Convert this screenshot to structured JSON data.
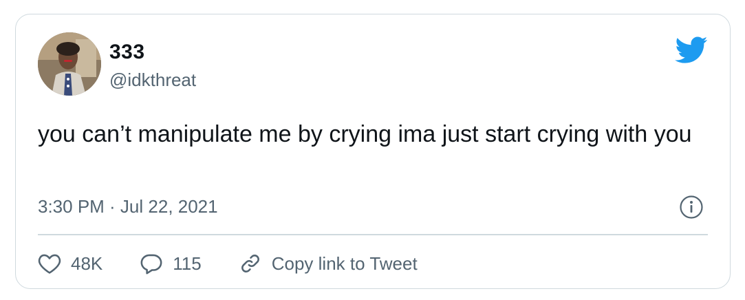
{
  "author": {
    "display_name": "333",
    "handle": "@idkthreat",
    "avatar_icon": "profile-photo"
  },
  "tweet": {
    "text": "you can’t manipulate me by crying ima just start crying with you",
    "timestamp": "3:30 PM · Jul 22, 2021"
  },
  "actions": {
    "likes_count": "48K",
    "replies_count": "115",
    "copy_link_label": "Copy link to Tweet"
  },
  "icons": {
    "brand": "twitter-bird-icon",
    "info": "info-icon",
    "like": "heart-icon",
    "reply": "reply-icon",
    "link": "link-icon"
  },
  "colors": {
    "brand_blue": "#1d9bf0",
    "text_primary": "#0f1419",
    "text_secondary": "#536471",
    "border": "#cfd9de"
  }
}
